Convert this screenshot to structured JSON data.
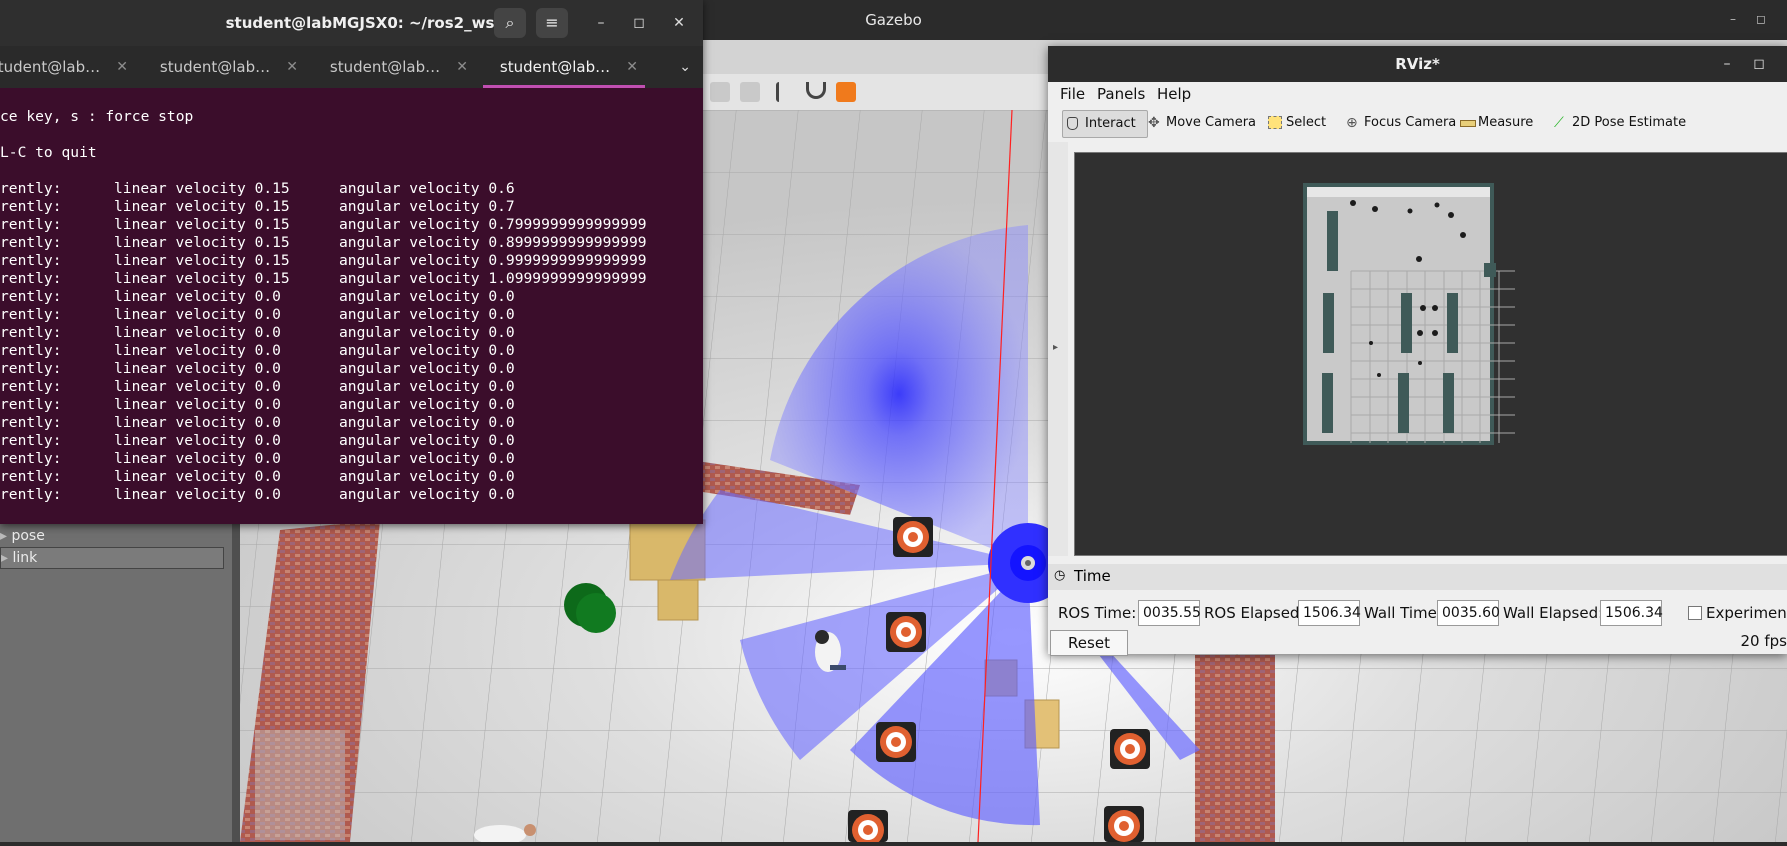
{
  "gazebo": {
    "title": "Gazebo",
    "tree_items": [
      "pose",
      "link"
    ]
  },
  "terminal": {
    "title": "student@labMGJSX0: ~/ros2_ws",
    "tabs": [
      "student@lab…",
      "student@lab…",
      "student@lab…",
      "student@lab…"
    ],
    "active_tab": 3,
    "header_lines": [
      "ce key, s : force stop",
      "L-C to quit"
    ],
    "lines": [
      {
        "prefix": "rently:",
        "linear": "linear velocity 0.15",
        "angular": "angular velocity 0.6"
      },
      {
        "prefix": "rently:",
        "linear": "linear velocity 0.15",
        "angular": "angular velocity 0.7"
      },
      {
        "prefix": "rently:",
        "linear": "linear velocity 0.15",
        "angular": "angular velocity 0.7999999999999999"
      },
      {
        "prefix": "rently:",
        "linear": "linear velocity 0.15",
        "angular": "angular velocity 0.8999999999999999"
      },
      {
        "prefix": "rently:",
        "linear": "linear velocity 0.15",
        "angular": "angular velocity 0.9999999999999999"
      },
      {
        "prefix": "rently:",
        "linear": "linear velocity 0.15",
        "angular": "angular velocity 1.0999999999999999"
      },
      {
        "prefix": "rently:",
        "linear": "linear velocity 0.0",
        "angular": "angular velocity 0.0"
      },
      {
        "prefix": "rently:",
        "linear": "linear velocity 0.0",
        "angular": "angular velocity 0.0"
      },
      {
        "prefix": "rently:",
        "linear": "linear velocity 0.0",
        "angular": "angular velocity 0.0"
      },
      {
        "prefix": "rently:",
        "linear": "linear velocity 0.0",
        "angular": "angular velocity 0.0"
      },
      {
        "prefix": "rently:",
        "linear": "linear velocity 0.0",
        "angular": "angular velocity 0.0"
      },
      {
        "prefix": "rently:",
        "linear": "linear velocity 0.0",
        "angular": "angular velocity 0.0"
      },
      {
        "prefix": "rently:",
        "linear": "linear velocity 0.0",
        "angular": "angular velocity 0.0"
      },
      {
        "prefix": "rently:",
        "linear": "linear velocity 0.0",
        "angular": "angular velocity 0.0"
      },
      {
        "prefix": "rently:",
        "linear": "linear velocity 0.0",
        "angular": "angular velocity 0.0"
      },
      {
        "prefix": "rently:",
        "linear": "linear velocity 0.0",
        "angular": "angular velocity 0.0"
      },
      {
        "prefix": "rently:",
        "linear": "linear velocity 0.0",
        "angular": "angular velocity 0.0"
      },
      {
        "prefix": "rently:",
        "linear": "linear velocity 0.0",
        "angular": "angular velocity 0.0"
      }
    ]
  },
  "rviz": {
    "title": "RViz*",
    "menu": [
      "File",
      "Panels",
      "Help"
    ],
    "tools": [
      "Interact",
      "Move Camera",
      "Select",
      "Focus Camera",
      "Measure",
      "2D Pose Estimate"
    ],
    "time_panel": {
      "title": "Time",
      "ros_time_label": "ROS Time:",
      "ros_time": "0035.55",
      "ros_elapsed_label": "ROS Elapsed:",
      "ros_elapsed": "1506.34",
      "wall_time_label": "Wall Time:",
      "wall_time": "0035.60",
      "wall_elapsed_label": "Wall Elapsed:",
      "wall_elapsed": "1506.34",
      "experimental_label": "Experimenta",
      "reset_label": "Reset",
      "fps": "20 fps"
    }
  },
  "colors": {
    "terminal_bg": "#3b0d2b",
    "tab_accent": "#c14fb2",
    "laser": "#2f2fff",
    "rviz_view": "#303030"
  }
}
